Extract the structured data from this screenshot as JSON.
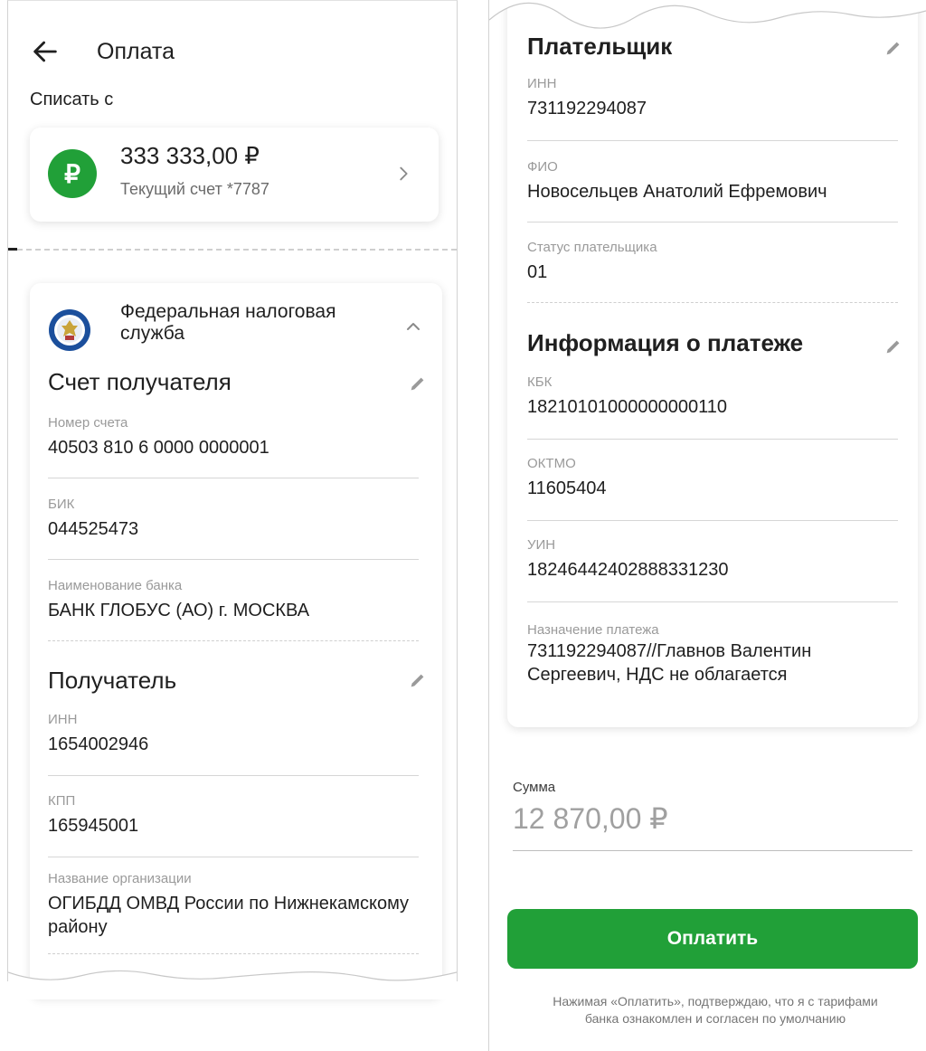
{
  "header": {
    "title": "Оплата"
  },
  "debit": {
    "label": "Списать с",
    "currency_symbol": "₽",
    "amount": "333 333,00 ₽",
    "account_name": "Текущий счет *7787"
  },
  "recipient_org": {
    "name": "Федеральная налоговая служба"
  },
  "recipient_account": {
    "title": "Счет получателя",
    "fields": [
      {
        "label": "Номер счета",
        "value": "40503 810 6 0000 0000001"
      },
      {
        "label": "БИК",
        "value": "044525473"
      },
      {
        "label": "Наименование банка",
        "value": "БАНК ГЛОБУС (АО) г. МОСКВА"
      }
    ]
  },
  "recipient": {
    "title": "Получатель",
    "fields": [
      {
        "label": "ИНН",
        "value": "1654002946"
      },
      {
        "label": "КПП",
        "value": "165945001"
      },
      {
        "label": "Название организации",
        "value": "ОГИБДД ОМВД России по Нижнекамскому району"
      }
    ]
  },
  "payer": {
    "title": "Плательщик",
    "fields": [
      {
        "label": "ИНН",
        "value": "731192294087"
      },
      {
        "label": "ФИО",
        "value": "Новосельцев Анатолий Ефремович"
      },
      {
        "label": "Статус плательщика",
        "value": "01"
      }
    ]
  },
  "payment_info": {
    "title": "Информация о платеже",
    "fields": [
      {
        "label": "КБК",
        "value": "18210101000000000110"
      },
      {
        "label": "ОКТМО",
        "value": "11605404"
      },
      {
        "label": "УИН",
        "value": "18246442402888331230"
      },
      {
        "label": "Назначение платежа",
        "value": "731192294087//Главнов Валентин Сергеевич, НДС не облагается"
      }
    ]
  },
  "amount": {
    "label": "Сумма",
    "value": "12 870,00 ₽"
  },
  "pay_button": {
    "label": "Оплатить"
  },
  "disclaimer": "Нажимая «Оплатить», подтверждаю, что я с тарифами банка ознакомлен и согласен по умолчанию",
  "colors": {
    "accent": "#21a038",
    "muted_text": "#9a9a9a",
    "divider": "#d6d6d6"
  },
  "icons": [
    "back-arrow-icon",
    "ruble-icon",
    "chevron-right-icon",
    "fns-emblem-icon",
    "chevron-up-icon",
    "edit-icon"
  ]
}
